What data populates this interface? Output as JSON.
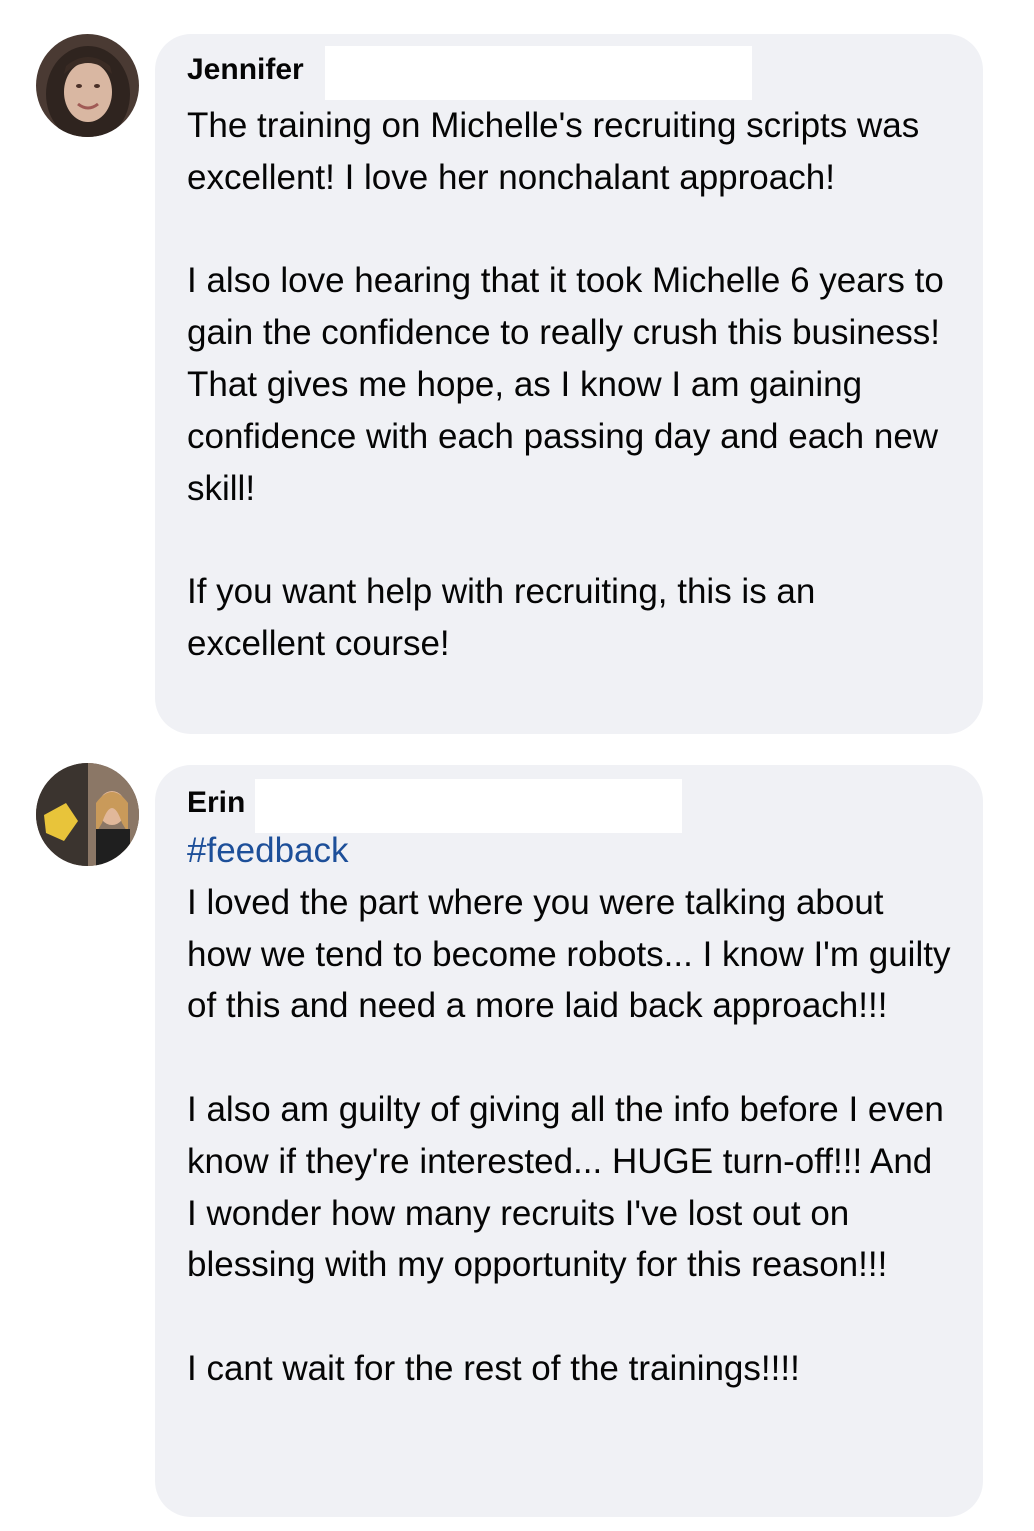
{
  "comments": [
    {
      "author": "Jennifer",
      "avatar_icon": "profile-photo-avatar",
      "text": "The training on Michelle's recruiting scripts was excellent! I love her nonchalant approach!\n\nI also love hearing that it took Michelle 6 years to gain the confidence to really crush this business! That gives me hope, as I know I am gaining confidence with each passing day and each new skill!\n\nIf you want help with recruiting, this is an excellent course!"
    },
    {
      "author": "Erin",
      "avatar_icon": "profile-photo-avatar",
      "hashtag": "#feedback",
      "text": "I loved the part where you were talking about how we tend to become robots... I know I'm guilty of this and need a more laid back approach!!!\n\nI also am guilty of giving all the info before I even know if they're interested... HUGE turn-off!!! And I wonder how many recruits I've lost out on blessing with my opportunity for this reason!!!\n\nI cant wait for the rest of the trainings!!!!"
    }
  ],
  "colors": {
    "bubble": "#f0f1f5",
    "text": "#050505",
    "hashtag": "#1d4f99",
    "redaction": "#ffffff"
  }
}
